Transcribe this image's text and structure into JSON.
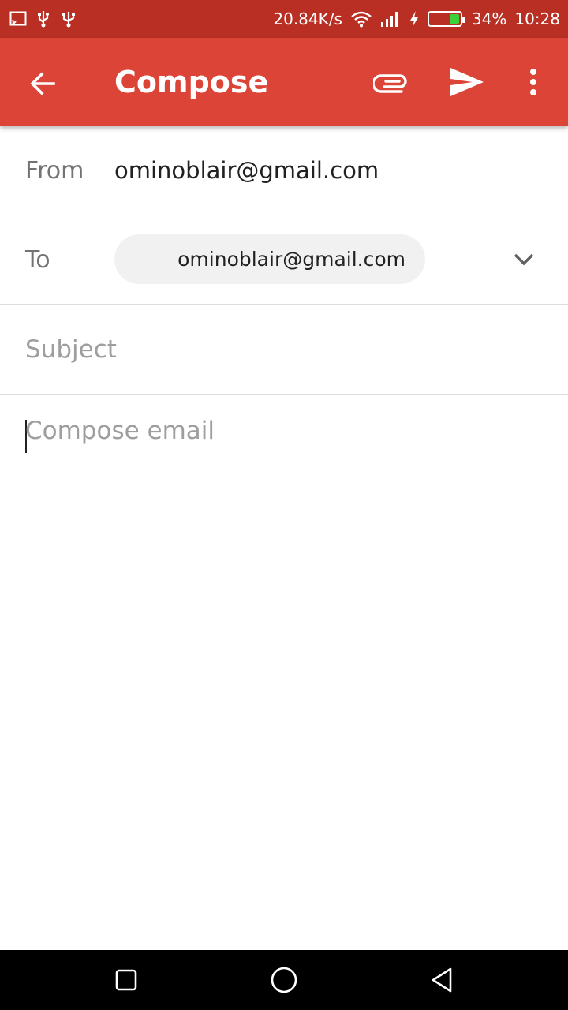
{
  "status_bar": {
    "icons_left": [
      "screen-cast-icon",
      "usb-debug-icon",
      "usb-icon"
    ],
    "net_speed": "20.84K/s",
    "battery_percent": "34%",
    "battery_level": 0.34,
    "battery_color": "#3bd33b",
    "time": "10:28"
  },
  "app_bar": {
    "title": "Compose",
    "color": "#db4437",
    "icons": [
      "back-arrow-icon",
      "attach-icon",
      "send-icon",
      "more-vert-icon"
    ]
  },
  "from": {
    "label": "From",
    "value": "ominoblair@gmail.com"
  },
  "to": {
    "label": "To",
    "recipient": "ominoblair@gmail.com"
  },
  "subject": {
    "placeholder": "Subject",
    "value": ""
  },
  "body": {
    "placeholder": "Compose email",
    "value": ""
  },
  "nav_bar": {
    "icons": [
      "recent-apps-icon",
      "home-icon",
      "back-icon"
    ]
  }
}
